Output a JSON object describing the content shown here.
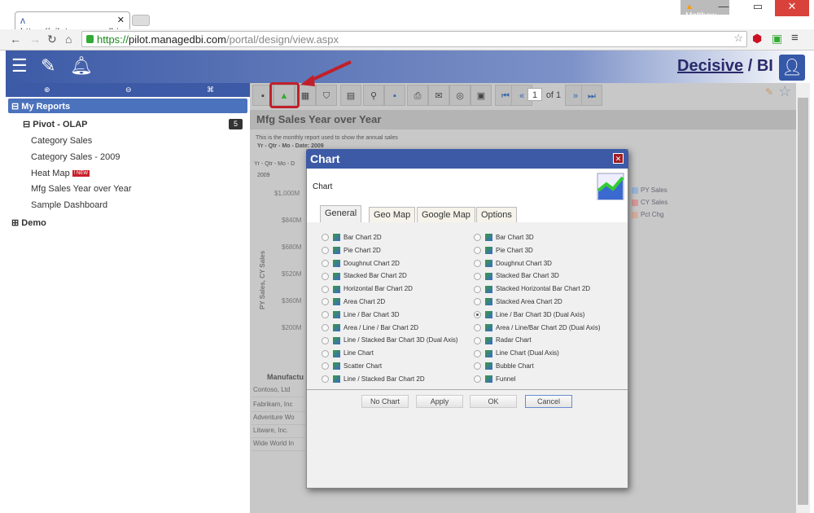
{
  "browser": {
    "tab_title": "https://pilot.managedbi.com",
    "user": "Matthew",
    "url_scheme": "https://",
    "url_domain": "pilot.managedbi.com",
    "url_path": "/portal/design/view.aspx"
  },
  "header": {
    "logo": "Decisive",
    "logo_suffix": "BI"
  },
  "sidebar": {
    "my_reports": "My Reports",
    "folder": "Pivot - OLAP",
    "folder_count": "5",
    "items": [
      {
        "label": "Category Sales"
      },
      {
        "label": "Category Sales - 2009"
      },
      {
        "label": "Heat Map",
        "badge": "! NEW"
      },
      {
        "label": "Mfg Sales Year over Year"
      },
      {
        "label": "Sample Dashboard"
      }
    ],
    "demo": "Demo"
  },
  "toolbar": {
    "page": "1",
    "of": "of 1"
  },
  "report": {
    "title": "Mfg Sales Year over Year",
    "description": "This is the monthly report used to show the annual sales",
    "filter": "Yr - Qtr - Mo - Date: 2009",
    "dim": "Yr - Qtr - Mo - D",
    "year": "2009",
    "y_axis_label": "PY Sales, CY Sales",
    "y_ticks": [
      "$1,000M",
      "$840M",
      "$680M",
      "$520M",
      "$360M",
      "$200M"
    ],
    "legend": [
      {
        "label": "PY Sales",
        "color": "#9ab8d8"
      },
      {
        "label": "CY Sales",
        "color": "#d89a9a"
      },
      {
        "label": "Pct Chg",
        "color": "#d8b0a0"
      }
    ],
    "manufacturer_header": "Manufactu",
    "manufacturers": [
      "Contoso, Ltd",
      "Fabrikam, Inc",
      "Adventure Wo",
      "Litware, Inc.",
      "Wide World In"
    ]
  },
  "dialog": {
    "title": "Chart",
    "heading": "Chart",
    "tabs": [
      "General",
      "Geo Map",
      "Google Map",
      "Options"
    ],
    "left_options": [
      "Bar Chart 2D",
      "Pie Chart 2D",
      "Doughnut Chart 2D",
      "Stacked Bar Chart 2D",
      "Horizontal Bar Chart 2D",
      "Area Chart 2D",
      "Line / Bar Chart 3D",
      "Area / Line / Bar Chart 2D",
      "Line / Stacked Bar Chart 3D (Dual Axis)",
      "Line Chart",
      "Scatter Chart",
      "Line / Stacked Bar Chart 2D"
    ],
    "right_options": [
      "Bar Chart 3D",
      "Pie Chart 3D",
      "Doughnut Chart 3D",
      "Stacked Bar Chart 3D",
      "Stacked Horizontal Bar Chart 2D",
      "Stacked Area Chart 2D",
      "Line / Bar Chart 3D (Dual Axis)",
      "Area / Line/Bar Chart 2D (Dual Axis)",
      "Radar Chart",
      "Line Chart (Dual Axis)",
      "Bubble Chart",
      "Funnel"
    ],
    "selected": "Line / Bar Chart 3D (Dual Axis)",
    "buttons": {
      "no_chart": "No Chart",
      "apply": "Apply",
      "ok": "OK",
      "cancel": "Cancel"
    }
  }
}
